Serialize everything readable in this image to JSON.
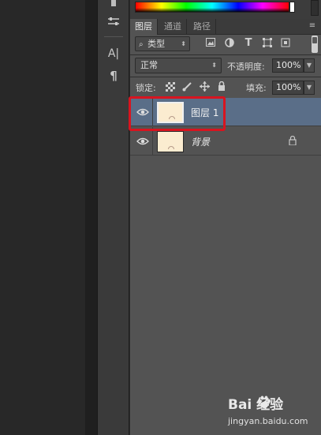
{
  "tabs": [
    {
      "label": "图层",
      "active": true
    },
    {
      "label": "通道",
      "active": false
    },
    {
      "label": "路径",
      "active": false
    }
  ],
  "filter": {
    "kind_label": "类型",
    "icons": [
      "image-filter-icon",
      "adjustment-filter-icon",
      "type-filter-icon",
      "shape-filter-icon",
      "smart-object-filter-icon"
    ]
  },
  "blend": {
    "mode": "正常",
    "opacity_label": "不透明度:",
    "opacity_value": "100%"
  },
  "lock": {
    "label": "锁定:",
    "fill_label": "填充:",
    "fill_value": "100%"
  },
  "layers": [
    {
      "name": "图层 1",
      "visible": true,
      "selected": true,
      "locked": false
    },
    {
      "name": "背景",
      "visible": true,
      "selected": false,
      "locked": true
    }
  ],
  "tools": [
    {
      "name": "type-tool-icon",
      "glyph": "A|"
    },
    {
      "name": "paragraph-icon",
      "glyph": "¶"
    }
  ],
  "watermark": {
    "brand_text": "Bai  经验",
    "url": "jingyan.baidu.com"
  },
  "colors": {
    "highlight": "#d8141f",
    "selected_layer": "#5a6e88",
    "panel": "#535353"
  }
}
